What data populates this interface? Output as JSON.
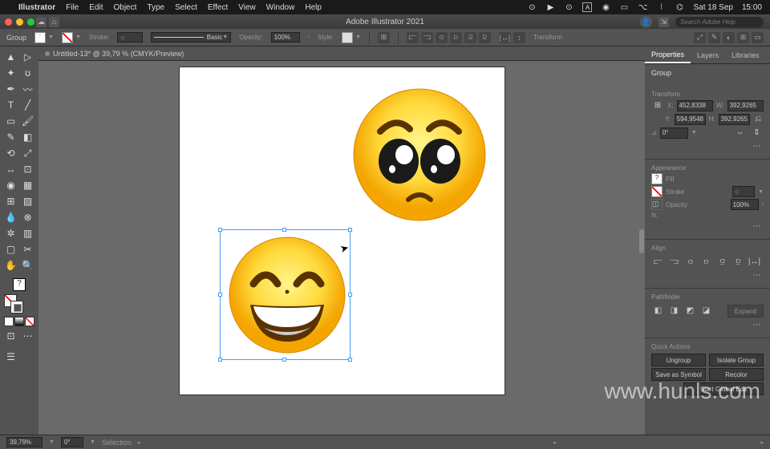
{
  "menubar": {
    "app": "Illustrator",
    "items": [
      "File",
      "Edit",
      "Object",
      "Type",
      "Select",
      "Effect",
      "View",
      "Window",
      "Help"
    ],
    "date": "Sat 18 Sep",
    "time": "15:00"
  },
  "title": "Adobe Illustrator 2021",
  "search_placeholder": "Search Adobe Help",
  "controlbar": {
    "target": "Group",
    "stroke_label": "Stroke:",
    "stroke_style": "Basic",
    "opacity_label": "Opacity:",
    "opacity": "100%",
    "style_label": "Style:",
    "transform_label": "Transform"
  },
  "doc_tab": "Untitled-13* @ 39,79 % (CMYK/Preview)",
  "panels": {
    "tabs": [
      "Properties",
      "Layers",
      "Libraries"
    ],
    "selection": "Group",
    "transform_title": "Transform",
    "x": "452,8338",
    "y": "594,9548",
    "w": "392,9265",
    "h": "392,9265",
    "rotate": "0°",
    "appearance_title": "Appearance",
    "fill_label": "Fill",
    "stroke_label": "Stroke",
    "opacity_label": "Opacity",
    "opacity_val": "100%",
    "fx": "fx.",
    "align_title": "Align",
    "pathfinder_title": "Pathfinder",
    "expand": "Expand",
    "quick_title": "Quick Actions",
    "ungroup": "Ungroup",
    "isolate": "Isolate Group",
    "save_symbol": "Save as Symbol",
    "recolor": "Recolor",
    "global_edit": "Start Global Edit"
  },
  "status": {
    "zoom": "39,79%",
    "rotate": "0°",
    "tool": "Selection"
  },
  "watermark": "www.hunls.com"
}
